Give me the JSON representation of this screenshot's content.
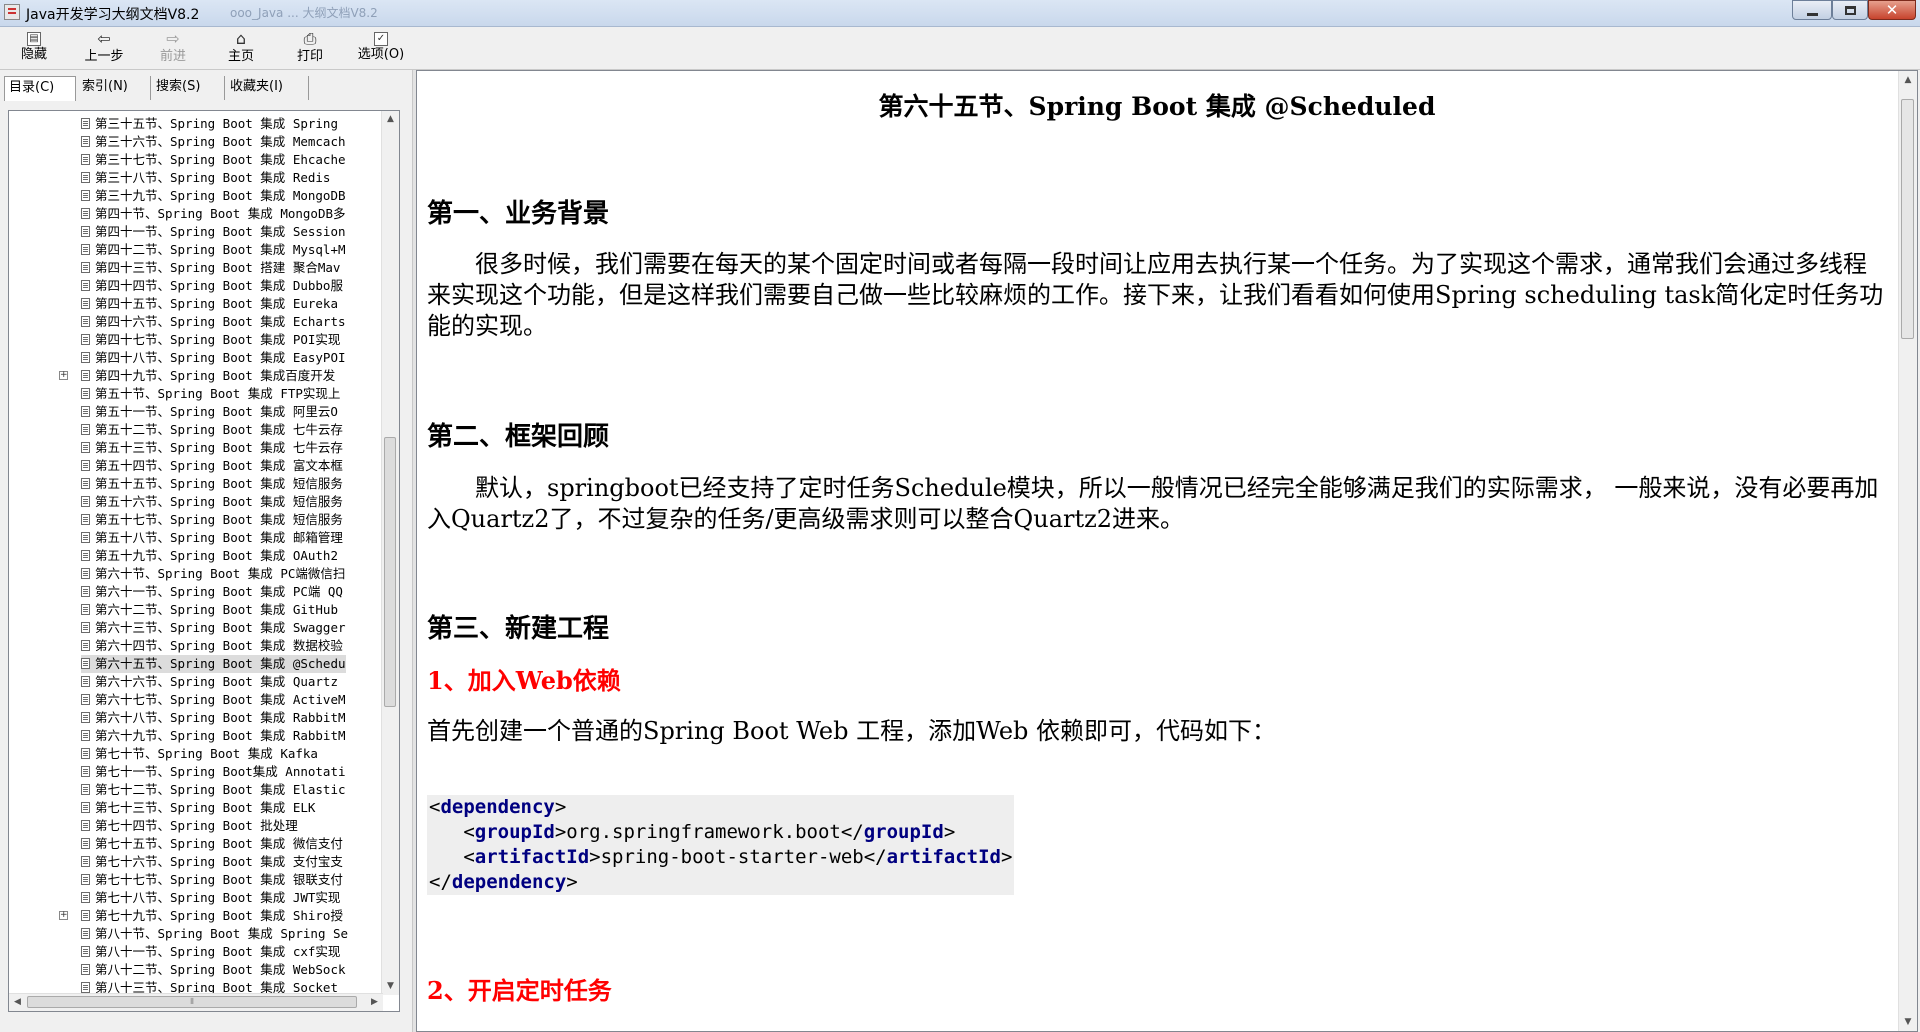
{
  "window": {
    "title": "Java开发学习大纲文档V8.2",
    "ghost_tab": "ooo_Java ...  大纲文档V8.2"
  },
  "toolbar": {
    "hide": "隐藏",
    "back": "上一步",
    "forward": "前进",
    "home": "主页",
    "print": "打印",
    "options": "选项(O)"
  },
  "tabs": {
    "contents": "目录(C)",
    "index": "索引(N)",
    "search": "搜索(S)",
    "favorites": "收藏夹(I)"
  },
  "tree": [
    "第三十五节、Spring Boot 集成 Spring",
    "第三十六节、Spring Boot 集成 Memcach",
    "第三十七节、Spring Boot 集成 Ehcache",
    "第三十八节、Spring Boot 集成 Redis",
    "第三十九节、Spring Boot 集成 MongoDB",
    "第四十节、Spring Boot 集成 MongoDB多",
    "第四十一节、Spring Boot 集成 Session",
    "第四十二节、Spring Boot 集成 Mysql+M",
    "第四十三节、Spring Boot 搭建 聚合Mav",
    "第四十四节、Spring Boot 集成 Dubbo服",
    "第四十五节、Spring Boot 集成 Eureka",
    "第四十六节、Spring Boot 集成 Echarts",
    "第四十七节、Spring Boot 集成 POI实现",
    "第四十八节、Spring Boot 集成 EasyPOI",
    "第四十九节、Spring Boot 集成百度开发",
    "第五十节、Spring Boot 集成 FTP实现上",
    "第五十一节、Spring Boot 集成 阿里云O",
    "第五十二节、Spring Boot 集成 七牛云存",
    "第五十三节、Spring Boot 集成 七牛云存",
    "第五十四节、Spring Boot 集成 富文本框",
    "第五十五节、Spring Boot 集成 短信服务",
    "第五十六节、Spring Boot 集成 短信服务",
    "第五十七节、Spring Boot 集成 短信服务",
    "第五十八节、Spring Boot 集成 邮箱管理",
    "第五十九节、Spring Boot 集成 OAuth2",
    "第六十节、Spring Boot 集成 PC端微信扫",
    "第六十一节、Spring Boot 集成 PC端 QQ",
    "第六十二节、Spring Boot 集成 GitHub",
    "第六十三节、Spring Boot 集成 Swagger",
    "第六十四节、Spring Boot 集成 数据校验",
    "第六十五节、Spring Boot 集成 @Schedu",
    "第六十六节、Spring Boot 集成 Quartz",
    "第六十七节、Spring Boot 集成 ActiveM",
    "第六十八节、Spring Boot 集成 RabbitM",
    "第六十九节、Spring Boot 集成 RabbitM",
    "第七十节、Spring Boot 集成 Kafka",
    "第七十一节、Spring Boot集成 Annotati",
    "第七十二节、Spring Boot 集成 Elastic",
    "第七十三节、Spring Boot 集成 ELK",
    "第七十四节、Spring Boot 批处理",
    "第七十五节、Spring Boot 集成 微信支付",
    "第七十六节、Spring Boot 集成 支付宝支",
    "第七十七节、Spring Boot 集成 银联支付",
    "第七十八节、Spring Boot 集成 JWT实现",
    "第七十九节、Spring Boot 集成 Shiro授",
    "第八十节、Spring Boot 集成 Spring Se",
    "第八十一节、Spring Boot 集成 cxf实现",
    "第八十二节、Spring Boot 集成 WebSock",
    "第八十三节、Spring Boot 集成 Socket"
  ],
  "article": {
    "title": "第六十五节、Spring Boot 集成 @Scheduled",
    "s1_heading": "第一、业务背景",
    "s1_para": "很多时候，我们需要在每天的某个固定时间或者每隔一段时间让应用去执行某一个任务。为了实现这个需求，通常我们会通过多线程来实现这个功能，但是这样我们需要自己做一些比较麻烦的工作。接下来，让我们看看如何使用Spring scheduling task简化定时任务功能的实现。",
    "s2_heading": "第二、框架回顾",
    "s2_para": "默认，springboot已经支持了定时任务Schedule模块，所以一般情况已经完全能够满足我们的实际需求， 一般来说，没有必要再加入Quartz2了，不过复杂的任务/更高级需求则可以整合Quartz2进来。",
    "s3_heading": "第三、新建工程",
    "step1": "1、加入Web依赖",
    "step1_text": "首先创建一个普通的Spring Boot Web 工程，添加Web 依赖即可，代码如下：",
    "code": {
      "dependency": "dependency",
      "groupId": "groupId",
      "groupId_value": "org.springframework.boot",
      "artifactId": "artifactId",
      "artifactId_value": "spring-boot-starter-web"
    },
    "step2": "2、开启定时任务"
  }
}
